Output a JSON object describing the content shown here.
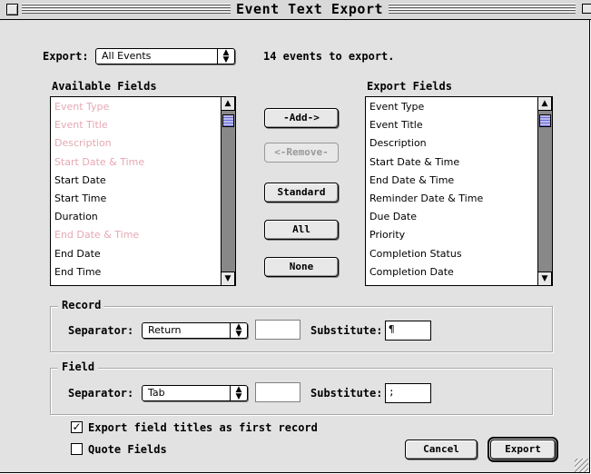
{
  "window": {
    "title": "Event Text Export"
  },
  "export": {
    "label": "Export:",
    "selected": "All Events",
    "count_text": "14 events to export."
  },
  "available": {
    "header": "Available Fields",
    "items": [
      {
        "label": "Event Type",
        "disabled": true
      },
      {
        "label": "Event Title",
        "disabled": true
      },
      {
        "label": "Description",
        "disabled": true
      },
      {
        "label": "Start Date & Time",
        "disabled": true
      },
      {
        "label": "Start Date",
        "disabled": false
      },
      {
        "label": "Start Time",
        "disabled": false
      },
      {
        "label": "Duration",
        "disabled": false
      },
      {
        "label": "End Date & Time",
        "disabled": true
      },
      {
        "label": "End Date",
        "disabled": false
      },
      {
        "label": "End Time",
        "disabled": false
      }
    ]
  },
  "export_fields": {
    "header": "Export Fields",
    "items": [
      "Event Type",
      "Event Title",
      "Description",
      "Start Date & Time",
      "End Date & Time",
      "Reminder Date & Time",
      "Due Date",
      "Priority",
      "Completion Status",
      "Completion Date"
    ]
  },
  "buttons": {
    "add": "-Add->",
    "remove": "<-Remove-",
    "standard": "Standard",
    "all": "All",
    "none": "None",
    "cancel": "Cancel",
    "export": "Export"
  },
  "record": {
    "label": "Record",
    "separator_label": "Separator:",
    "separator_value": "Return",
    "substitute_label": "Substitute:",
    "substitute_value": "¶"
  },
  "field": {
    "label": "Field",
    "separator_label": "Separator:",
    "separator_value": "Tab",
    "substitute_label": "Substitute:",
    "substitute_value": ";"
  },
  "options": {
    "export_titles": {
      "label": "Export field titles as first record",
      "checked": true
    },
    "quote_fields": {
      "label": "Quote Fields",
      "checked": false
    }
  },
  "colors": {
    "dimmed_text": "#e6a8b4",
    "scroll_thumb": "#b9b9f0"
  }
}
